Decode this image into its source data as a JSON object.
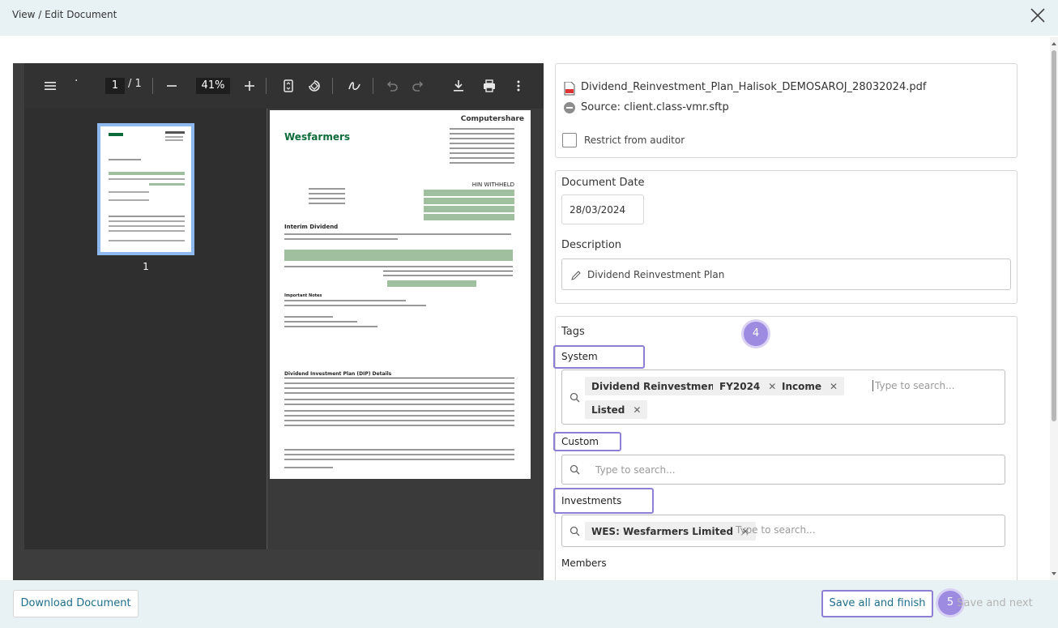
{
  "header": {
    "title": "View / Edit Document"
  },
  "viewer": {
    "page_current": "1",
    "page_total": "/ 1",
    "zoom": "41%",
    "thumb_label": "1",
    "doc": {
      "brand": "Wesfarmers",
      "provider": "Computershare",
      "hin": "HIN WITHHELD",
      "heading": "Interim Dividend",
      "notes": "Important Notes",
      "dip": "Dividend Investment Plan (DIP) Details"
    }
  },
  "file": {
    "name": "Dividend_Reinvestment_Plan_Halisok_DEMOSAROJ_28032024.pdf",
    "source": "Source: client.class-vmr.sftp",
    "restrict_label": "Restrict from auditor"
  },
  "details": {
    "date_label": "Document Date",
    "date_value": "28/03/2024",
    "description_label": "Description",
    "description_value": "Dividend Reinvestment Plan"
  },
  "tags": {
    "label": "Tags",
    "badge_4": "4",
    "system_label": "System",
    "system_chips": [
      "Dividend Reinvestment",
      "FY2024",
      "Income",
      "Listed"
    ],
    "custom_label": "Custom",
    "investments_label": "Investments",
    "investment_chips": [
      "WES: Wesfarmers Limited"
    ],
    "members_label": "Members",
    "search_placeholder": "Type to search..."
  },
  "footer": {
    "download_label": "Download Document",
    "save_finish_label": "Save all and finish",
    "save_next_label": "Save and next",
    "badge_5": "5"
  },
  "colors": {
    "accent": "#1f6e8c",
    "highlight": "#8d7fd6",
    "header_bg": "#e8f2f4"
  }
}
